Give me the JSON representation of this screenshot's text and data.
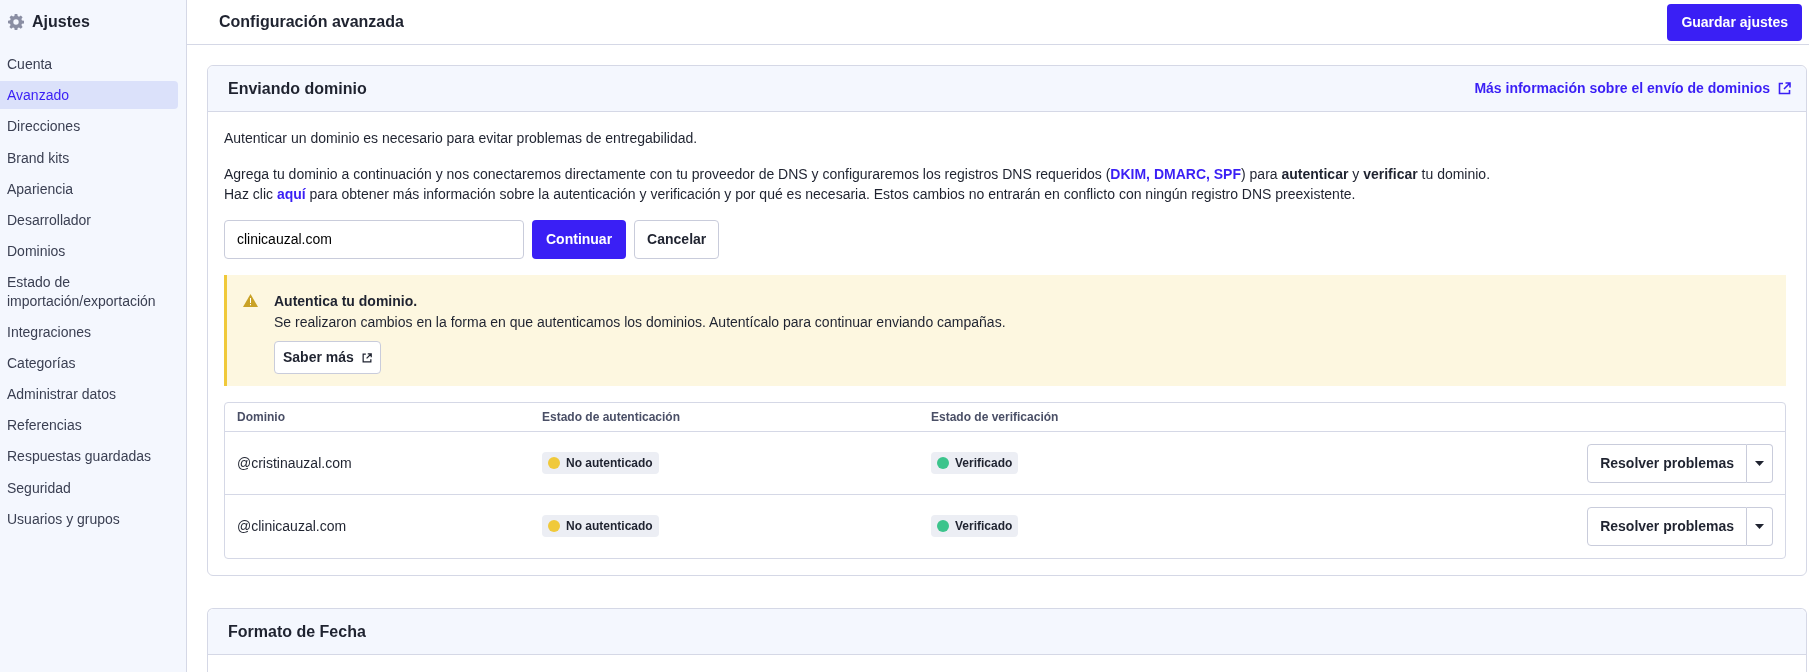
{
  "sidebar": {
    "title": "Ajustes",
    "items": [
      {
        "label": "Cuenta",
        "selected": false
      },
      {
        "label": "Avanzado",
        "selected": true
      },
      {
        "label": "Direcciones",
        "selected": false
      },
      {
        "label": "Brand kits",
        "selected": false
      },
      {
        "label": "Apariencia",
        "selected": false
      },
      {
        "label": "Desarrollador",
        "selected": false
      },
      {
        "label": "Dominios",
        "selected": false
      },
      {
        "label": "Estado de importación/exportación",
        "selected": false
      },
      {
        "label": "Integraciones",
        "selected": false
      },
      {
        "label": "Categorías",
        "selected": false
      },
      {
        "label": "Administrar datos",
        "selected": false
      },
      {
        "label": "Referencias",
        "selected": false
      },
      {
        "label": "Respuestas guardadas",
        "selected": false
      },
      {
        "label": "Seguridad",
        "selected": false
      },
      {
        "label": "Usuarios y grupos",
        "selected": false
      }
    ]
  },
  "header": {
    "title": "Configuración avanzada",
    "save_button": "Guardar ajustes"
  },
  "sending_domain": {
    "title": "Enviando dominio",
    "info_link": "Más información sobre el envío de dominios",
    "intro": "Autenticar un dominio es necesario para evitar problemas de entregabilidad.",
    "lines": [
      [
        {
          "kind": "text",
          "text": "Agrega tu dominio a continuación y nos conectaremos directamente con tu proveedor de DNS y configuraremos los registros DNS requeridos ("
        },
        {
          "kind": "link",
          "text": "DKIM, DMARC, SPF"
        },
        {
          "kind": "text",
          "text": ") para **autenticar** y **verificar** tu dominio."
        }
      ],
      [
        {
          "kind": "text",
          "text": "Haz clic "
        },
        {
          "kind": "link",
          "text": "aquí"
        },
        {
          "kind": "text",
          "text": " para obtener más información sobre la autenticación y verificación y por qué es necesaria. Estos cambios no entrarán en conflicto con ningún registro DNS preexistente."
        }
      ]
    ],
    "domain_input": "clinicauzal.com",
    "continue_button": "Continuar",
    "cancel_button": "Cancelar",
    "alert": {
      "title": "Autentica tu dominio.",
      "message": "Se realizaron cambios en la forma en que autenticamos los dominios. Autentícalo para continuar enviando campañas.",
      "button": "Saber más"
    },
    "table": {
      "columns": [
        "Dominio",
        "Estado de autenticación",
        "Estado de verificación"
      ],
      "rows": [
        {
          "domain": "@cristinauzal.com",
          "auth": {
            "text": "No autenticado",
            "color": "#f0c93a"
          },
          "verification": {
            "text": "Verificado",
            "color": "#3cc48c"
          },
          "action": "Resolver problemas"
        },
        {
          "domain": "@clinicauzal.com",
          "auth": {
            "text": "No autenticado",
            "color": "#f0c93a"
          },
          "verification": {
            "text": "Verificado",
            "color": "#3cc48c"
          },
          "action": "Resolver problemas"
        }
      ]
    }
  },
  "date_format": {
    "title": "Formato de Fecha"
  }
}
